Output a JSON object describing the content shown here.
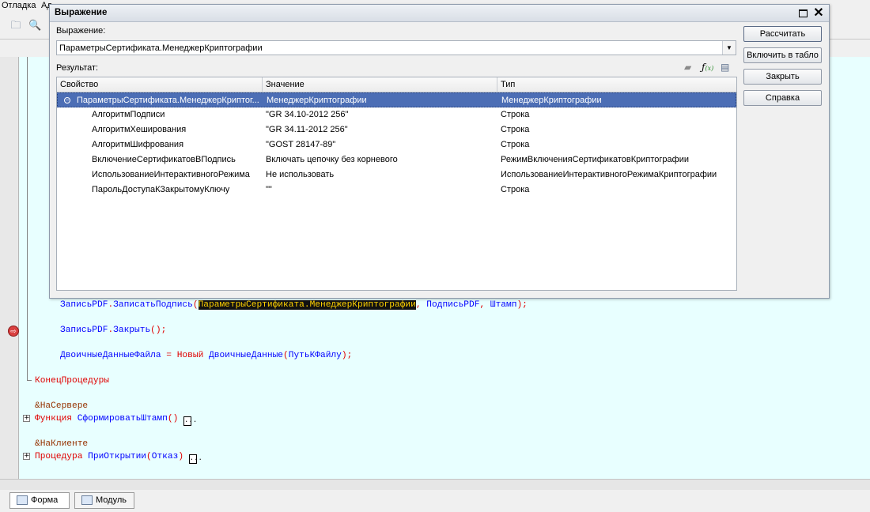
{
  "menubar": {
    "items": [
      "Отладка",
      "Ад"
    ]
  },
  "dialog": {
    "title": "Выражение",
    "expression_label": "Выражение:",
    "expression_value": "ПараметрыСертификата.МенеджерКриптографии",
    "result_label": "Результат:",
    "columns": [
      "Свойство",
      "Значение",
      "Тип"
    ],
    "rows": [
      {
        "property": "ПараметрыСертификата.МенеджерКриптог...",
        "value": "МенеджерКриптографии",
        "type": "МенеджерКриптографии"
      },
      {
        "property": "АлгоритмПодписи",
        "value": "\"GR 34.10-2012 256\"",
        "type": "Строка"
      },
      {
        "property": "АлгоритмХеширования",
        "value": "\"GR 34.11-2012 256\"",
        "type": "Строка"
      },
      {
        "property": "АлгоритмШифрования",
        "value": "\"GOST 28147-89\"",
        "type": "Строка"
      },
      {
        "property": "ВключениеСертификатовВПодпись",
        "value": "Включать цепочку без корневого",
        "type": "РежимВключенияСертификатовКриптографии"
      },
      {
        "property": "ИспользованиеИнтерактивногоРежима",
        "value": "Не использовать",
        "type": "ИспользованиеИнтерактивногоРежимаКриптографии"
      },
      {
        "property": "ПарольДоступаКЗакрытомуКлючу",
        "value": "\"\"",
        "type": "Строка"
      }
    ],
    "buttons": {
      "calculate": "Рассчитать",
      "add_to_table": "Включить в табло",
      "close": "Закрыть",
      "help": "Справка"
    }
  },
  "code": {
    "line1_obj": "ЗаписьPDF",
    "line1_method": "ЗаписатьПодпись",
    "line1_hl": "ПараметрыСертификата.МенеджерКриптографии",
    "line1_arg2": "ПодписьPDF",
    "line1_arg3": "Штамп",
    "line2_obj": "ЗаписьPDF",
    "line2_method": "Закрыть",
    "line3_var": "ДвоичныеДанныеФайла",
    "line3_new": "Новый",
    "line3_type": "ДвоичныеДанные",
    "line3_arg": "ПутьКФайлу",
    "end_proc": "КонецПроцедуры",
    "directive_server": "&НаСервере",
    "func_kw": "Функция",
    "func_name": "СформироватьШтамп",
    "directive_client": "&НаКлиенте",
    "proc_kw": "Процедура",
    "proc_name": "ПриОткрытии",
    "proc_arg": "Отказ"
  },
  "bottom_tabs": [
    "Форма",
    "Модуль"
  ]
}
